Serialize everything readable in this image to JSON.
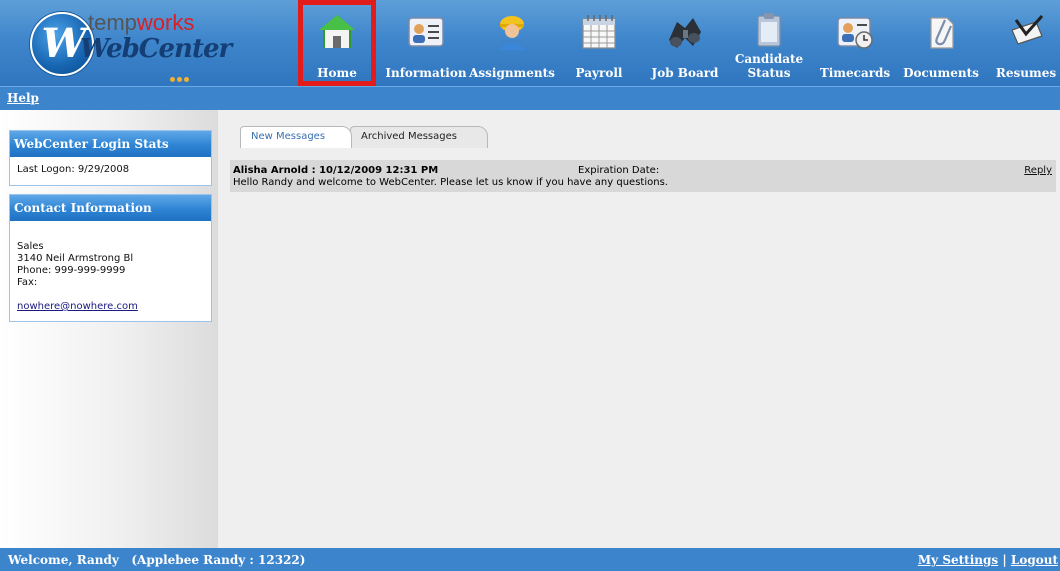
{
  "logo": {
    "brand_prefix": "temp",
    "brand_suffix": "works",
    "product": "WebCenter",
    "mark": "W"
  },
  "nav": {
    "items": [
      {
        "label": "Home",
        "icon": "home-icon",
        "active": true
      },
      {
        "label": "Information",
        "icon": "id-card-icon",
        "active": false
      },
      {
        "label": "Assignments",
        "icon": "worker-icon",
        "active": false
      },
      {
        "label": "Payroll",
        "icon": "calendar-icon",
        "active": false
      },
      {
        "label": "Job Board",
        "icon": "binoculars-icon",
        "active": false
      },
      {
        "label": "Candidate Status",
        "label_line1": "Candidate",
        "label_line2": "Status",
        "icon": "clipboard-icon",
        "active": false
      },
      {
        "label": "Timecards",
        "icon": "timecard-icon",
        "active": false
      },
      {
        "label": "Documents",
        "icon": "paperclip-icon",
        "active": false
      },
      {
        "label": "Resumes",
        "icon": "resume-icon",
        "active": false
      }
    ]
  },
  "helpbar": {
    "help_label": "Help"
  },
  "sidebar": {
    "login_stats": {
      "title": "WebCenter Login Stats",
      "last_logon": "Last Logon: 9/29/2008"
    },
    "contact": {
      "title": "Contact Information",
      "department": "Sales",
      "address": "3140 Neil Armstrong Bl",
      "phone": "Phone: 999-999-9999",
      "fax": "Fax:",
      "email": "nowhere@nowhere.com"
    }
  },
  "main": {
    "tabs": [
      {
        "label": "New Messages",
        "active": true
      },
      {
        "label": "Archived Messages",
        "active": false
      }
    ],
    "message": {
      "from": "Alisha Arnold : 10/12/2009 12:31 PM",
      "expiration": "Expiration Date:",
      "body": "Hello Randy and welcome to WebCenter. Please let us know if you have any questions.",
      "reply": "Reply"
    }
  },
  "footer": {
    "welcome": "Welcome, Randy   (Applebee Randy : 12322)",
    "settings": "My Settings",
    "separator": "|",
    "logout": "Logout"
  },
  "colors": {
    "header_blue": "#3f86cc",
    "active_outline": "#e21b1b",
    "home_green": "#2e9b2e"
  }
}
